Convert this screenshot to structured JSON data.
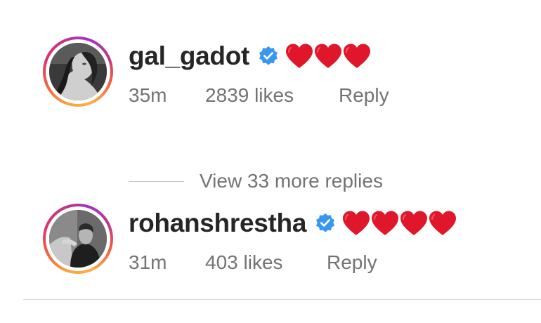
{
  "comments": [
    {
      "username": "gal_gadot",
      "verified": true,
      "hearts": 3,
      "time": "35m",
      "likes": "2839 likes",
      "reply_label": "Reply"
    },
    {
      "username": "rohanshrestha",
      "verified": true,
      "hearts": 4,
      "time": "31m",
      "likes": "403 likes",
      "reply_label": "Reply"
    }
  ],
  "view_more_replies": "View 33 more replies",
  "icons": {
    "verified": "verified-badge-icon",
    "heart": "red-heart-emoji"
  },
  "colors": {
    "verified_blue": "#3897f0",
    "heart_red": "#e0162b",
    "username": "#262626",
    "secondary": "#737373"
  }
}
